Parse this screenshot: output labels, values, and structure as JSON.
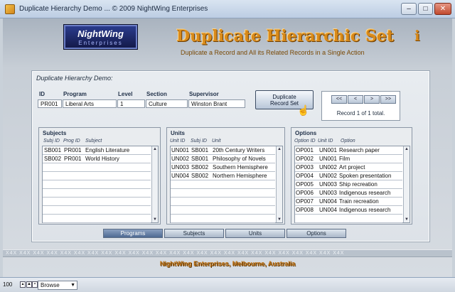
{
  "window": {
    "title": "Duplicate Hierarchy Demo  ...  © 2009 NightWing Enterprises",
    "min": "–",
    "max": "□",
    "close": "✕"
  },
  "header": {
    "logo_line1": "NightWing",
    "logo_line2": "Enterprises",
    "title": "Duplicate Hierarchic Set",
    "subtitle": "Duplicate a Record and All its Related Records in a Single Action",
    "info": "i"
  },
  "panel": {
    "title": "Duplicate Hierarchy Demo:",
    "record": {
      "headers": [
        "ID",
        "Program",
        "Level",
        "Section",
        "Supervisor"
      ],
      "values": [
        "PR001",
        "Liberal Arts",
        "1",
        "Culture",
        "Winston Brant"
      ]
    },
    "duplicate_button": "Duplicate\nRecord Set",
    "nav": {
      "first": "<<",
      "prev": "<",
      "next": ">",
      "last": ">>",
      "status": "Record 1 of 1 total."
    },
    "subjects": {
      "title": "Subjects",
      "headers": [
        "Subj ID",
        "Prog ID",
        "Subject"
      ],
      "rows": [
        [
          "SB001",
          "PR001",
          "English Literature"
        ],
        [
          "SB002",
          "PR001",
          "World History"
        ]
      ]
    },
    "units": {
      "title": "Units",
      "headers": [
        "Unit ID",
        "Subj ID",
        "Unit"
      ],
      "rows": [
        [
          "UN001",
          "SB001",
          "20th Century Writers"
        ],
        [
          "UN002",
          "SB001",
          "Philosophy of Novels"
        ],
        [
          "UN003",
          "SB002",
          "Southern Hemisphere"
        ],
        [
          "UN004",
          "SB002",
          "Northern Hemisphere"
        ]
      ]
    },
    "options": {
      "title": "Options",
      "headers": [
        "Option ID",
        "Unit ID",
        "Option"
      ],
      "rows": [
        [
          "OP001",
          "UN001",
          "Research paper"
        ],
        [
          "OP002",
          "UN001",
          "Film"
        ],
        [
          "OP003",
          "UN002",
          "Art project"
        ],
        [
          "OP004",
          "UN002",
          "Spoken presentation"
        ],
        [
          "OP005",
          "UN003",
          "Ship recreation"
        ],
        [
          "OP006",
          "UN003",
          "Indigenous research"
        ],
        [
          "OP007",
          "UN004",
          "Train recreation"
        ],
        [
          "OP008",
          "UN004",
          "Indigenous research"
        ]
      ]
    }
  },
  "tabs": [
    "Programs",
    "Subjects",
    "Units",
    "Options"
  ],
  "band": "X4X   X4X   X4X   X4X   X4X   X4X   X4X   X4X   X4X   X4X   X4X   X4X   X4X   X4X   X4X   X4X   X4X   X4X   X4X   X4X   X4X   X4X   X4X   X4X   X4X",
  "footer": "NightWing Enterprises, Melbourne, Australia",
  "statusbar": {
    "zoom": "100",
    "mode": "Browse"
  },
  "colors": {
    "accent": "#d98a1a",
    "logo_bg": "#1a2260",
    "tab_active": "#4e6a93"
  }
}
